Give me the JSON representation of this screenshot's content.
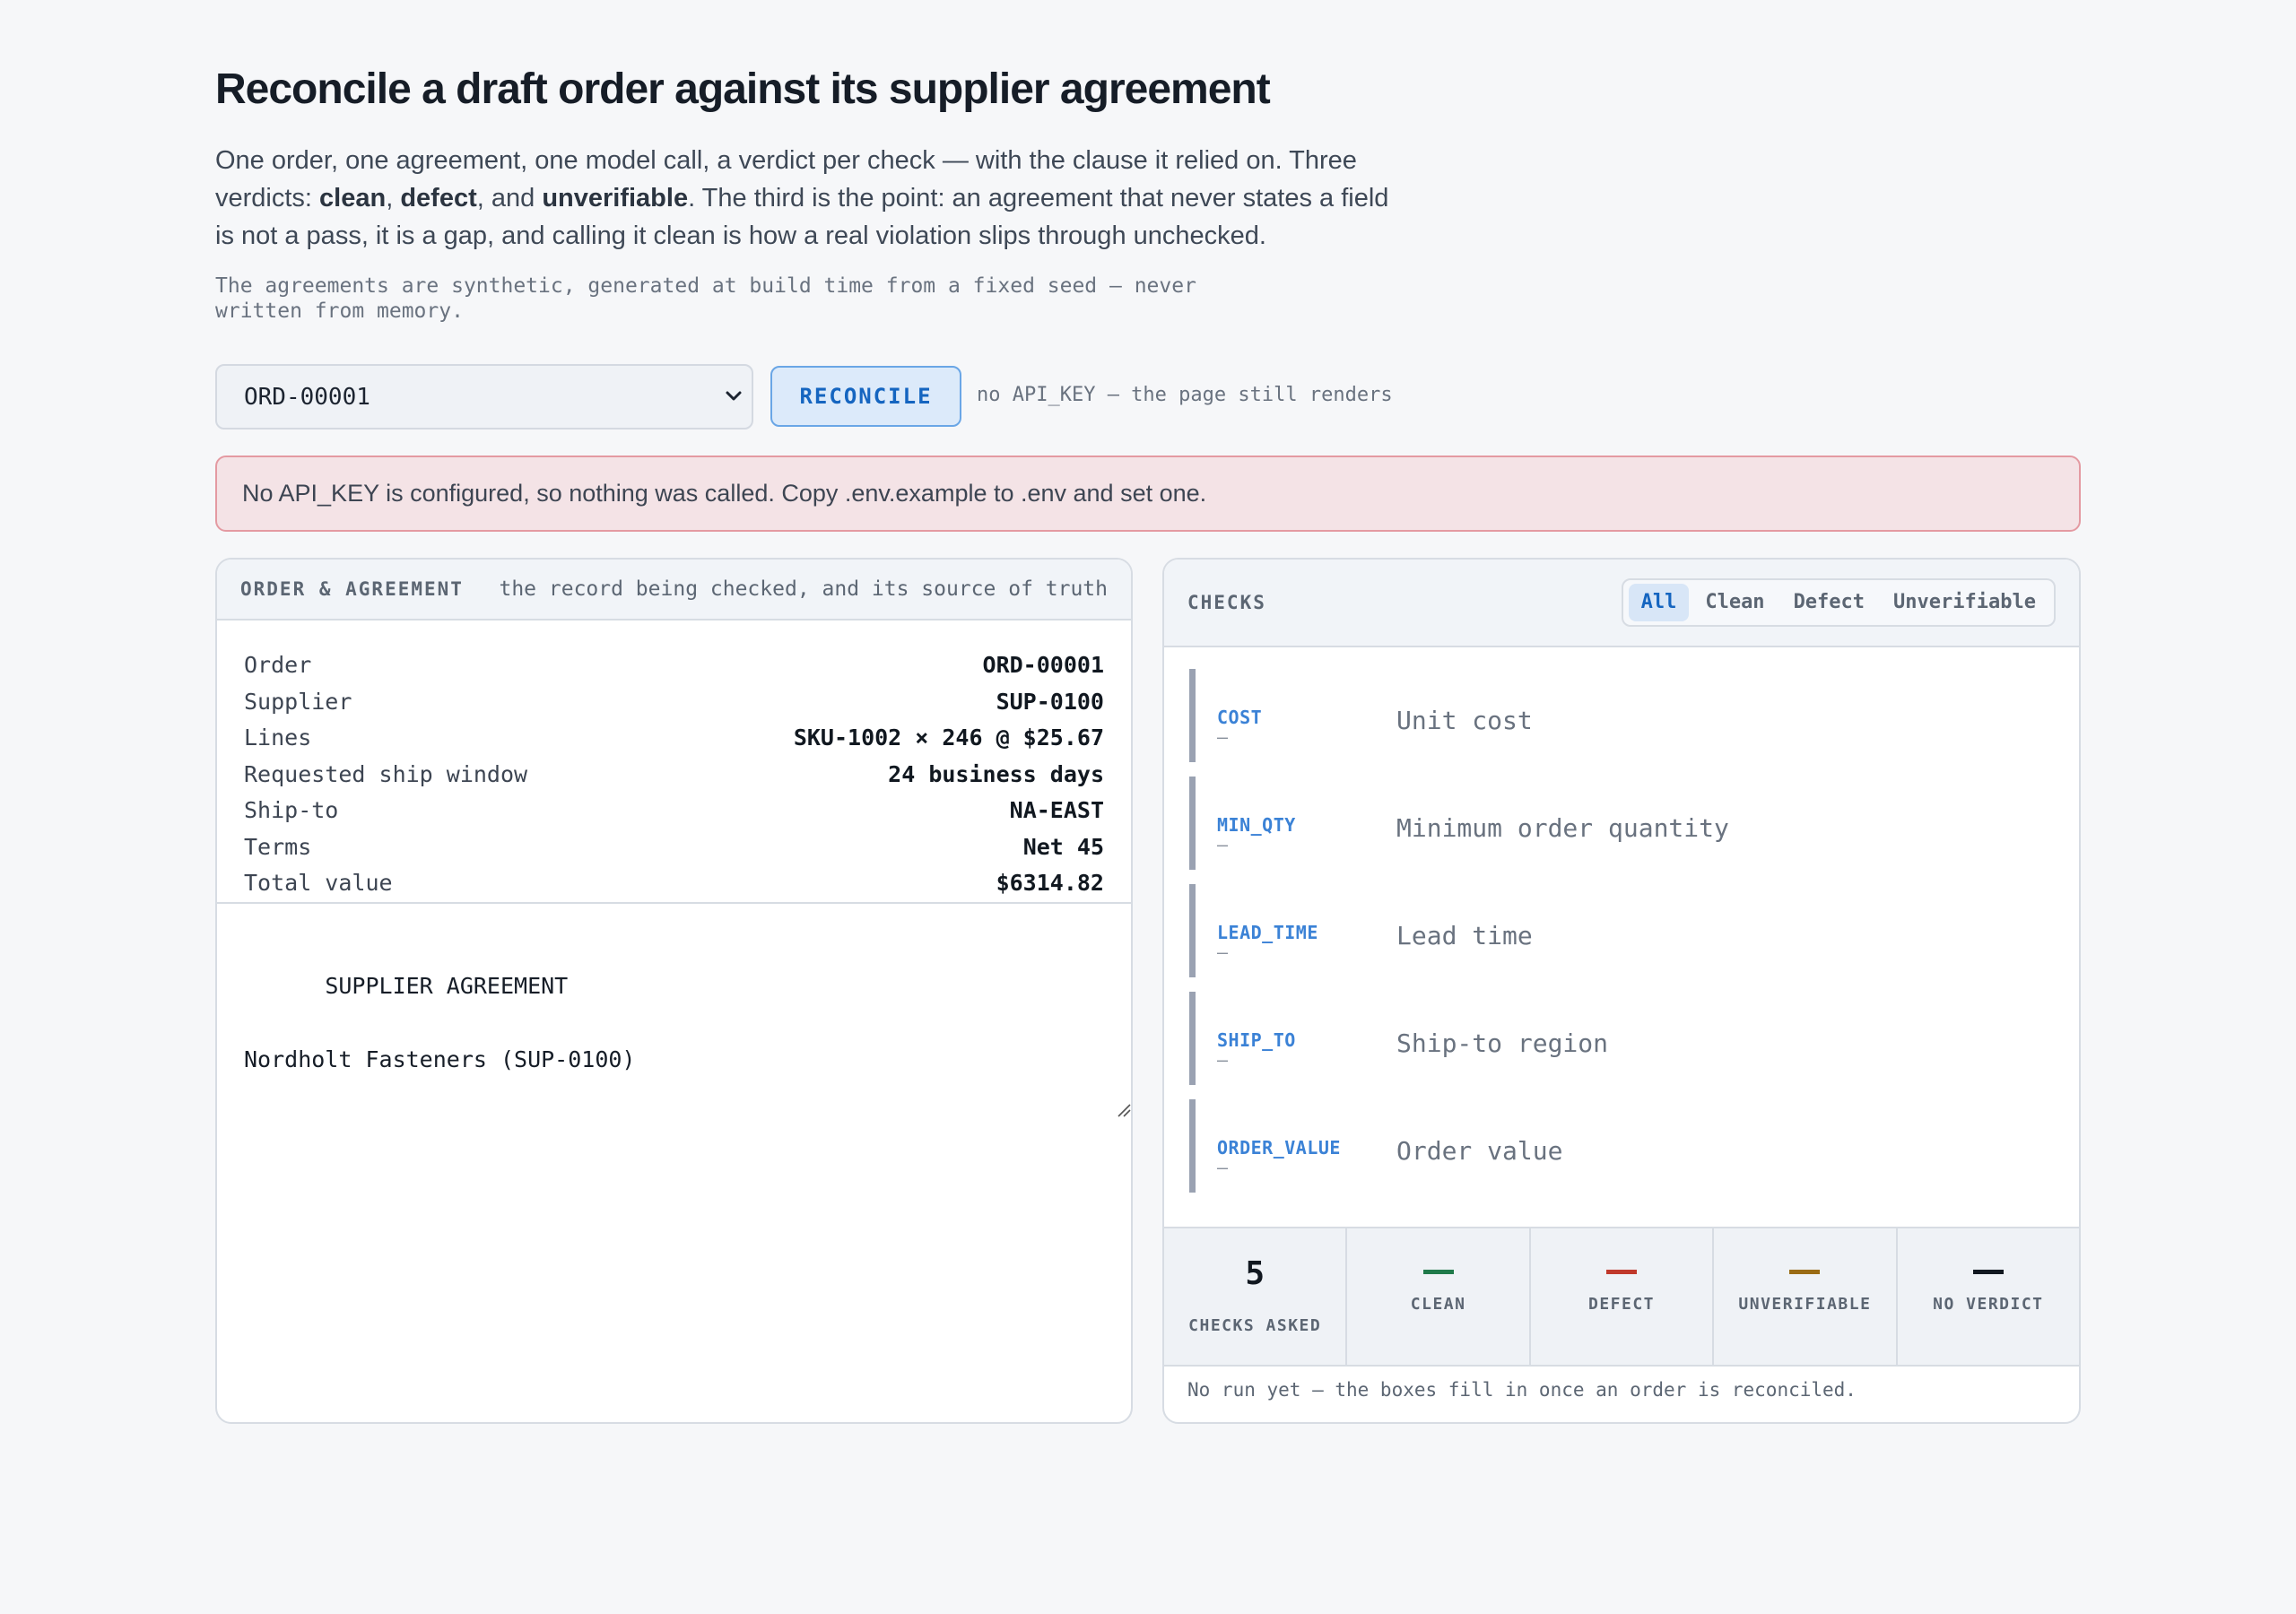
{
  "header": {
    "title": "Reconcile a draft order against its supplier agreement",
    "lede_part1": "One order, one agreement, one model call, a verdict per check — with the clause it relied on. Three verdicts: ",
    "lede_clean": "clean",
    "lede_sep1": ", ",
    "lede_defect": "defect",
    "lede_sep2": ", and ",
    "lede_unverifiable": "unverifiable",
    "lede_part2": ". The third is the point: an agreement that never states a field is not a pass, it is a gap, and calling it clean is how a real violation slips through unchecked.",
    "note": "The agreements are synthetic, generated at build time from a fixed seed — never written from memory."
  },
  "controls": {
    "order_select_value": "ORD-00001",
    "reconcile_label": "RECONCILE",
    "api_hint": "no API_KEY — the page still renders"
  },
  "alert": {
    "text": "No API_KEY is configured, so nothing was called. Copy .env.example to .env and set one."
  },
  "left_panel": {
    "title": "ORDER & AGREEMENT",
    "subtitle": "the record being checked, and its source of truth",
    "fields": [
      {
        "key": "Order",
        "value": "ORD-00001"
      },
      {
        "key": "Supplier",
        "value": "SUP-0100"
      },
      {
        "key": "Lines",
        "value": "SKU-1002 × 246 @ $25.67"
      },
      {
        "key": "Requested ship window",
        "value": "24 business days"
      },
      {
        "key": "Ship-to",
        "value": "NA-EAST"
      },
      {
        "key": "Terms",
        "value": "Net 45"
      },
      {
        "key": "Total value",
        "value": "$6314.82"
      }
    ],
    "agreement_text": "SUPPLIER AGREEMENT\n\nNordholt Fasteners (SUP-0100)"
  },
  "right_panel": {
    "title": "CHECKS",
    "tabs": [
      "All",
      "Clean",
      "Defect",
      "Unverifiable"
    ],
    "active_tab": "All",
    "checks": [
      {
        "code": "COST",
        "verdict": "—",
        "label": "Unit cost"
      },
      {
        "code": "MIN_QTY",
        "verdict": "—",
        "label": "Minimum order quantity"
      },
      {
        "code": "LEAD_TIME",
        "verdict": "—",
        "label": "Lead time"
      },
      {
        "code": "SHIP_TO",
        "verdict": "—",
        "label": "Ship-to region"
      },
      {
        "code": "ORDER_VALUE",
        "verdict": "—",
        "label": "Order value"
      }
    ],
    "stats": [
      {
        "value": "5",
        "label": "CHECKS ASKED",
        "color": "#111820"
      },
      {
        "value": "",
        "label": "CLEAN",
        "color": "#1f7a4a"
      },
      {
        "value": "",
        "label": "DEFECT",
        "color": "#c0392b"
      },
      {
        "value": "",
        "label": "UNVERIFIABLE",
        "color": "#9a6b14"
      },
      {
        "value": "",
        "label": "NO VERDICT",
        "color": "#111820"
      }
    ],
    "footer": "No run yet — the boxes fill in once an order is reconciled."
  },
  "colors": {
    "accent": "#1565c0",
    "alert_bg": "#f4e3e6",
    "alert_border": "#e49aa2",
    "check_bar": "#9aa2b2"
  }
}
